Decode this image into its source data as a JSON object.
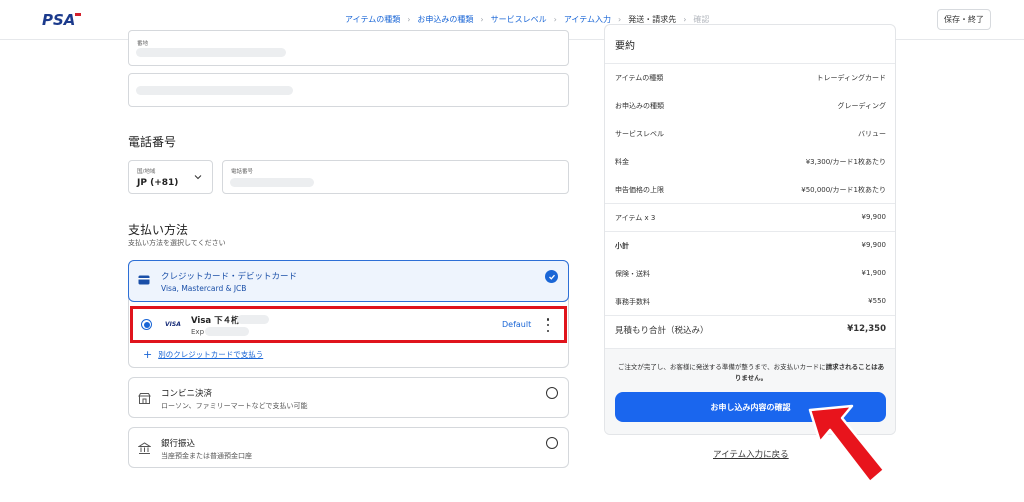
{
  "header": {
    "logo_text": "PSA",
    "steps": [
      {
        "label": "アイテムの種類"
      },
      {
        "label": "お申込みの種類"
      },
      {
        "label": "サービスレベル"
      },
      {
        "label": "アイテム入力"
      },
      {
        "label": "発送・請求先"
      },
      {
        "label": "確認"
      }
    ],
    "save_exit_label": "保存・終了"
  },
  "address": {
    "number_label": "番地"
  },
  "phone": {
    "section_title": "電話番号",
    "country_label": "国/地域",
    "country_value": "JP (+81)",
    "number_label": "電話番号"
  },
  "payment": {
    "section_title": "支払い方法",
    "section_subtitle": "支払い方法を選択してください",
    "card": {
      "title": "クレジットカード・デビットカード",
      "subtitle": "Visa, Mastercard & JCB"
    },
    "saved_card": {
      "brand": "VISA",
      "title": "Visa 下４桁",
      "exp_label": "Exp",
      "default_label": "Default"
    },
    "add_card_label": "別のクレジットカードで支払う",
    "konbini": {
      "title": "コンビニ決済",
      "subtitle": "ローソン、ファミリーマートなどで支払い可能"
    },
    "bank": {
      "title": "銀行振込",
      "subtitle": "当座預金または普通預金口座"
    }
  },
  "summary": {
    "title": "要約",
    "rows": [
      {
        "label": "アイテムの種類",
        "value": "トレーディングカード"
      },
      {
        "label": "お申込みの種類",
        "value": "グレーディング"
      },
      {
        "label": "サービスレベル",
        "value": "バリュー"
      },
      {
        "label": "料金",
        "value": "¥3,300/カード1枚あたり"
      },
      {
        "label": "申告価格の上限",
        "value": "¥50,000/カード1枚あたり"
      },
      {
        "label": "アイテム x 3",
        "value": "¥9,900"
      },
      {
        "label": "小計",
        "value": "¥9,900"
      },
      {
        "label": "保険・送料",
        "value": "¥1,900"
      },
      {
        "label": "事務手数料",
        "value": "¥550"
      },
      {
        "label": "見積もり合計（税込み）",
        "value": "¥12,350"
      }
    ],
    "notice_prefix": "ご注文が完了し、お客様に発送する準備が整うまで、お支払いカードに",
    "notice_bold": "請求されることはありません。",
    "confirm_label": "お申し込み内容の確認",
    "back_label": "アイテム入力に戻る"
  },
  "colors": {
    "accent": "#1a66ee",
    "highlight": "#e0141c"
  }
}
